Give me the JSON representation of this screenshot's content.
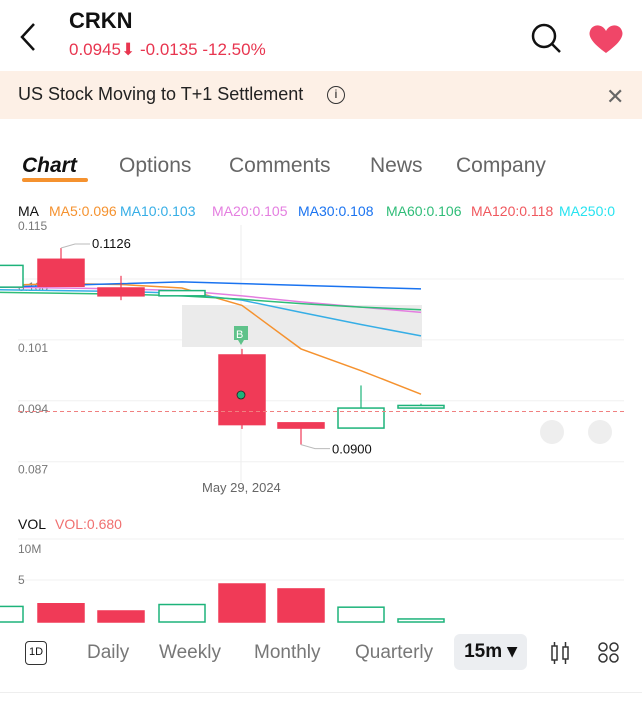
{
  "header": {
    "title": "CRKN",
    "price": "0.0945",
    "change": "-0.0135",
    "change_pct": "-12.50%"
  },
  "banner": {
    "text": "US Stock Moving to T+1 Settlement"
  },
  "tabs": [
    "Chart",
    "Options",
    "Comments",
    "News",
    "Company"
  ],
  "ma": {
    "label": "MA",
    "items": [
      {
        "t": "MA5:0.096",
        "c": "#f5922f"
      },
      {
        "t": "MA10:0.103",
        "c": "#36aee6"
      },
      {
        "t": "MA20:0.105",
        "c": "#e47ee0"
      },
      {
        "t": "MA30:0.108",
        "c": "#1a73f0"
      },
      {
        "t": "MA60:0.106",
        "c": "#2fbd78"
      },
      {
        "t": "MA120:0.118",
        "c": "#f0585e"
      },
      {
        "t": "MA250:0",
        "c": "#27e3f0"
      }
    ]
  },
  "chart_data": {
    "type": "candlestick",
    "y_ticks": [
      "0.115",
      "0.108",
      "0.101",
      "0.094",
      "0.087"
    ],
    "x_label": "May 29, 2024",
    "high_label": "0.1126",
    "low_label": "0.0900",
    "marker": "B",
    "last_price": 0.0945,
    "candles": [
      {
        "o": 0.1081,
        "c": 0.1106,
        "h": 0.1106,
        "l": 0.1081
      },
      {
        "o": 0.1113,
        "c": 0.1082,
        "h": 0.1126,
        "l": 0.1082
      },
      {
        "o": 0.108,
        "c": 0.1071,
        "h": 0.1094,
        "l": 0.1066
      },
      {
        "o": 0.1071,
        "c": 0.1077,
        "h": 0.1077,
        "l": 0.1071
      },
      {
        "o": 0.1003,
        "c": 0.0923,
        "h": 0.101,
        "l": 0.0918
      },
      {
        "o": 0.0925,
        "c": 0.0919,
        "h": 0.0925,
        "l": 0.09
      },
      {
        "o": 0.0919,
        "c": 0.0942,
        "h": 0.0968,
        "l": 0.0919
      },
      {
        "o": 0.0942,
        "c": 0.0945,
        "h": 0.0947,
        "l": 0.0942
      }
    ],
    "ma_lines": [
      {
        "name": "MA5",
        "color": "#f5922f",
        "v": [
          0.1083,
          0.1085,
          0.1084,
          0.108,
          0.106,
          0.101,
          0.0985,
          0.0958
        ]
      },
      {
        "name": "MA10",
        "color": "#36aee6",
        "v": [
          0.1078,
          0.1077,
          0.1076,
          0.1074,
          0.1066,
          0.1052,
          0.1038,
          0.1025
        ]
      },
      {
        "name": "MA20",
        "color": "#e47ee0",
        "v": [
          0.1081,
          0.108,
          0.1079,
          0.1077,
          0.1071,
          0.1064,
          0.1058,
          0.1052
        ]
      },
      {
        "name": "MA30",
        "color": "#1a73f0",
        "v": [
          0.1081,
          0.1083,
          0.1085,
          0.1087,
          0.1085,
          0.1083,
          0.1081,
          0.1079
        ]
      },
      {
        "name": "MA60",
        "color": "#2fbd78",
        "v": [
          0.1075,
          0.1074,
          0.1073,
          0.1071,
          0.1067,
          0.1062,
          0.1058,
          0.1055
        ]
      }
    ],
    "volume": {
      "label": "VOL",
      "value_label": "VOL:0.680",
      "y_ticks": [
        "10M",
        "5"
      ],
      "values": [
        4.1,
        4.8,
        2.9,
        4.6,
        10,
        8.7,
        3.9,
        0.8
      ]
    }
  },
  "bottom": {
    "items": [
      "Daily",
      "Weekly",
      "Monthly",
      "Quarterly"
    ],
    "interval": "15m ▾",
    "day_icon": "1D"
  },
  "colors": {
    "up": "#1db37a",
    "down": "#f03a57"
  }
}
